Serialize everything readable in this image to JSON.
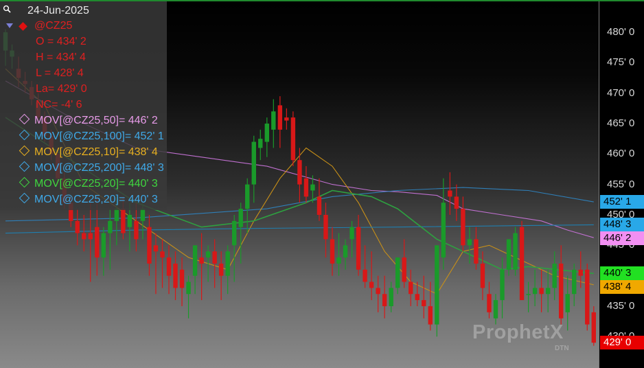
{
  "legend": {
    "date": "24-Jun-2025",
    "symbol": "@CZ25",
    "open": "O = 434' 2",
    "high": "H = 434' 4",
    "low": "L = 428' 4",
    "last": "La= 429' 0",
    "net_change": "NC= -4' 6",
    "moving_averages": [
      {
        "label": "MOV[@CZ25,50]= 446' 2",
        "color": "#e79be8"
      },
      {
        "label": "MOV[@CZ25,100]= 452' 1",
        "color": "#3fa9e8"
      },
      {
        "label": "MOV[@CZ25,10]= 438' 4",
        "color": "#e8b020"
      },
      {
        "label": "MOV[@CZ25,200]= 448' 3",
        "color": "#3fa9e8"
      },
      {
        "label": "MOV[@CZ25,20]= 440' 3",
        "color": "#3fd63f"
      },
      {
        "label": "MOV[@CZ25,20]= 440' 3",
        "color": "#3fa9e8"
      }
    ]
  },
  "axis": {
    "tick_labels": [
      "480' 0",
      "475' 0",
      "470' 0",
      "465' 0",
      "460' 0",
      "455' 0",
      "450' 0",
      "445' 0",
      "440' 0",
      "435' 0",
      "430' 0"
    ]
  },
  "price_tags": [
    {
      "label": "452' 1",
      "value": 452.125,
      "bg": "#29a8e8",
      "color": "#000000"
    },
    {
      "label": "448' 3",
      "value": 448.375,
      "bg": "#29a8e8",
      "color": "#000000"
    },
    {
      "label": "446' 2",
      "value": 446.25,
      "bg": "#f28ff2",
      "color": "#000000"
    },
    {
      "label": "440' 3",
      "value": 440.375,
      "bg": "#22e022",
      "color": "#000000"
    },
    {
      "label": "438' 4",
      "value": 438.5,
      "bg": "#f0a800",
      "color": "#000000"
    },
    {
      "label": "429' 0",
      "value": 429.0,
      "bg": "#e80000",
      "color": "#ffffff"
    }
  ],
  "watermark": {
    "brand": "ProphetX",
    "sub": "DTN"
  },
  "colors": {
    "up": "#1a9a2a",
    "down": "#d81818",
    "ma50": "#c070d0",
    "ma100": "#2f7fb8",
    "ma10": "#c89018",
    "ma200": "#1f7fb0",
    "ma20": "#2ea040"
  },
  "chart_data": {
    "type": "candlestick",
    "symbol": "@CZ25",
    "ylim": [
      427.5,
      484
    ],
    "y_ticks": [
      430,
      435,
      440,
      445,
      450,
      455,
      460,
      465,
      470,
      475,
      480
    ],
    "candles": [
      [
        477,
        480.5,
        474.5,
        480
      ],
      [
        476,
        478,
        474,
        477
      ],
      [
        474,
        476,
        471,
        472.5
      ],
      [
        472,
        473.5,
        470,
        471.5
      ],
      [
        471,
        472,
        468,
        469
      ],
      [
        468.5,
        470,
        465,
        466
      ],
      [
        466,
        467,
        462,
        463
      ],
      [
        463,
        464,
        459,
        460
      ],
      [
        460,
        461,
        455,
        456
      ],
      [
        456,
        457,
        451,
        452
      ],
      [
        452,
        453,
        448,
        449
      ],
      [
        449,
        451,
        445,
        447
      ],
      [
        447,
        450,
        444,
        446
      ],
      [
        447,
        452,
        439,
        446
      ],
      [
        448,
        453,
        440,
        443
      ],
      [
        443,
        448,
        440,
        447
      ],
      [
        447,
        451,
        441,
        449
      ],
      [
        449,
        453,
        445,
        451
      ],
      [
        451,
        453,
        446,
        447
      ],
      [
        448,
        452,
        444,
        450
      ],
      [
        449,
        452,
        444,
        446
      ],
      [
        449,
        452,
        446,
        451
      ],
      [
        448,
        450,
        440,
        442
      ],
      [
        445,
        447,
        437,
        444
      ],
      [
        444,
        446,
        438,
        443
      ],
      [
        443,
        445,
        437,
        440
      ],
      [
        442,
        444,
        436,
        438
      ],
      [
        441,
        443,
        435,
        438
      ],
      [
        437,
        440,
        433,
        439
      ],
      [
        440,
        445,
        437,
        445
      ],
      [
        443,
        447,
        436,
        442
      ],
      [
        443,
        445,
        439,
        444
      ],
      [
        444,
        446,
        438,
        442
      ],
      [
        442,
        444,
        436,
        440
      ],
      [
        440,
        445,
        437,
        444
      ],
      [
        445,
        450,
        439,
        449
      ],
      [
        448,
        452,
        442,
        451
      ],
      [
        451,
        456,
        447,
        455
      ],
      [
        455,
        463,
        452,
        462
      ],
      [
        461,
        464,
        459,
        462.5
      ],
      [
        462,
        466,
        459.5,
        465
      ],
      [
        464,
        469,
        461,
        467
      ],
      [
        468,
        469.5,
        461,
        464
      ],
      [
        466,
        467.5,
        464,
        465.5
      ],
      [
        466,
        467,
        458,
        459
      ],
      [
        459,
        461,
        452,
        455
      ],
      [
        456,
        458,
        452,
        453
      ],
      [
        454,
        456.5,
        452,
        455
      ],
      [
        453,
        456,
        449,
        450
      ],
      [
        450,
        452,
        443,
        446
      ],
      [
        446,
        448,
        440,
        442
      ],
      [
        442,
        447,
        440,
        443
      ],
      [
        443,
        446,
        441,
        445
      ],
      [
        446,
        449,
        443,
        448
      ],
      [
        448,
        450,
        440,
        441
      ],
      [
        441,
        445,
        438,
        439
      ],
      [
        439,
        444,
        436,
        438
      ],
      [
        438,
        440,
        434,
        437
      ],
      [
        437,
        440,
        433,
        435
      ],
      [
        435,
        439,
        434,
        438
      ],
      [
        438,
        443,
        437,
        443
      ],
      [
        443,
        446,
        438,
        439
      ],
      [
        439,
        441,
        435,
        437
      ],
      [
        437,
        439,
        435,
        436
      ],
      [
        436,
        440,
        433,
        435
      ],
      [
        435,
        439,
        431,
        432
      ],
      [
        432,
        445,
        430,
        445
      ],
      [
        443,
        456,
        441,
        452
      ],
      [
        454,
        457,
        450,
        453
      ],
      [
        453,
        455,
        449,
        451
      ],
      [
        451,
        453,
        444,
        445
      ],
      [
        445,
        448,
        442,
        446
      ],
      [
        446,
        448,
        441,
        442
      ],
      [
        442,
        444,
        436,
        438
      ],
      [
        437,
        439,
        433,
        434
      ],
      [
        433,
        437,
        432,
        436
      ],
      [
        436,
        443,
        433,
        441
      ],
      [
        441,
        446,
        440,
        446
      ],
      [
        441,
        448,
        440,
        447
      ],
      [
        448,
        449,
        437,
        436
      ],
      [
        437,
        439,
        434,
        437
      ],
      [
        437,
        441,
        435,
        438
      ],
      [
        438,
        441,
        434,
        437
      ],
      [
        437,
        441,
        434,
        438
      ],
      [
        438,
        444,
        436,
        442
      ],
      [
        442,
        445,
        432,
        433
      ],
      [
        434,
        440,
        431,
        437
      ],
      [
        437,
        442,
        435,
        441
      ],
      [
        441,
        444,
        438,
        440
      ],
      [
        441,
        442,
        431,
        432
      ],
      [
        434,
        435,
        428.5,
        429
      ]
    ],
    "moving_averages": [
      {
        "name": "MOV[@CZ25,50]",
        "value_last": 446.25,
        "points": [
          [
            0,
            472
          ],
          [
            10,
            466
          ],
          [
            20,
            461
          ],
          [
            30,
            459.5
          ],
          [
            40,
            458
          ],
          [
            50,
            455
          ],
          [
            56,
            454
          ],
          [
            60,
            453.8
          ],
          [
            66,
            453.2
          ],
          [
            70,
            451
          ],
          [
            76,
            450
          ],
          [
            82,
            449
          ],
          [
            86,
            447.5
          ],
          [
            90,
            446.25
          ]
        ]
      },
      {
        "name": "MOV[@CZ25,100]",
        "value_last": 452.125,
        "points": [
          [
            0,
            449
          ],
          [
            20,
            449.5
          ],
          [
            40,
            451
          ],
          [
            50,
            453
          ],
          [
            60,
            454
          ],
          [
            70,
            454.5
          ],
          [
            80,
            454
          ],
          [
            90,
            452.125
          ]
        ]
      },
      {
        "name": "MOV[@CZ25,10]",
        "value_last": 438.5,
        "points": [
          [
            0,
            474
          ],
          [
            6,
            468
          ],
          [
            12,
            455
          ],
          [
            20,
            449
          ],
          [
            28,
            443
          ],
          [
            34,
            441
          ],
          [
            38,
            449
          ],
          [
            42,
            456
          ],
          [
            46,
            461
          ],
          [
            50,
            458
          ],
          [
            54,
            452
          ],
          [
            58,
            444
          ],
          [
            62,
            439
          ],
          [
            66,
            437
          ],
          [
            70,
            444
          ],
          [
            74,
            445
          ],
          [
            78,
            443
          ],
          [
            84,
            440
          ],
          [
            90,
            438.5
          ]
        ]
      },
      {
        "name": "MOV[@CZ25,200]",
        "value_last": 448.375,
        "points": [
          [
            0,
            447
          ],
          [
            20,
            447.5
          ],
          [
            40,
            447.8
          ],
          [
            60,
            448
          ],
          [
            90,
            448.375
          ]
        ]
      },
      {
        "name": "MOV[@CZ25,20]",
        "value_last": 440.375,
        "points": [
          [
            0,
            466
          ],
          [
            10,
            459
          ],
          [
            20,
            452
          ],
          [
            30,
            448
          ],
          [
            38,
            449
          ],
          [
            46,
            452
          ],
          [
            50,
            454
          ],
          [
            56,
            453
          ],
          [
            60,
            451
          ],
          [
            66,
            446
          ],
          [
            70,
            444
          ],
          [
            76,
            441
          ],
          [
            80,
            441.5
          ],
          [
            90,
            440.375
          ]
        ]
      }
    ]
  }
}
